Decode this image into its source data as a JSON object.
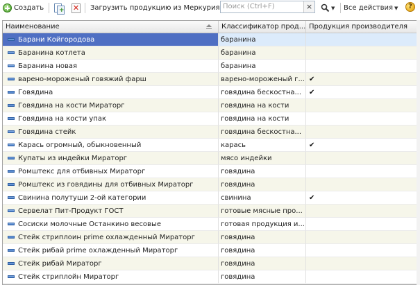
{
  "toolbar": {
    "create_label": "Создать",
    "load_label": "Загрузить продукцию из Меркурия",
    "search_placeholder": "Поиск (Ctrl+F)",
    "all_actions_label": "Все действия",
    "search_clear": "×",
    "help": "?"
  },
  "table": {
    "columns": [
      "Наименование",
      "Классификатор прод...",
      "Продукция производителя"
    ],
    "selected_row": 0,
    "rows": [
      {
        "name": "Барани Койгородова",
        "cls": "баранина",
        "own": ""
      },
      {
        "name": "Баранина котлета",
        "cls": "баранина",
        "own": ""
      },
      {
        "name": "Баранина новая",
        "cls": "баранина",
        "own": ""
      },
      {
        "name": "варено-мороженый говяжий фарш",
        "cls": "варено-мороженый г...",
        "own": "✔"
      },
      {
        "name": "Говядина",
        "cls": "говядина бескостна...",
        "own": "✔"
      },
      {
        "name": "Говядина на кости Мираторг",
        "cls": "говядина на кости",
        "own": ""
      },
      {
        "name": "Говядина на кости упак",
        "cls": "говядина на кости",
        "own": ""
      },
      {
        "name": "Говядина стейк",
        "cls": "говядина бескостна...",
        "own": ""
      },
      {
        "name": "Карась огромный, обыкновенный",
        "cls": "карась",
        "own": "✔"
      },
      {
        "name": "Купаты из индейки Мираторг",
        "cls": "мясо индейки",
        "own": ""
      },
      {
        "name": "Ромштекс для отбивных Мираторг",
        "cls": "говядина",
        "own": ""
      },
      {
        "name": "Ромштекс из говядины для отбивных Мираторг",
        "cls": "говядина",
        "own": ""
      },
      {
        "name": "Свинина полутуши 2-ой категории",
        "cls": "свинина",
        "own": "✔"
      },
      {
        "name": "Сервелат Пит-Продукт ГОСТ",
        "cls": "готовые мясные про...",
        "own": ""
      },
      {
        "name": "Сосиски молочные Останкино весовые",
        "cls": "готовая продукция и...",
        "own": ""
      },
      {
        "name": "Стейк стриплоин prime охлажденный Мираторг",
        "cls": "говядина",
        "own": ""
      },
      {
        "name": "Стейк рибай prime охлажденный Мираторг",
        "cls": "говядина",
        "own": ""
      },
      {
        "name": "Стейк рибай Мираторг",
        "cls": "говядина",
        "own": ""
      },
      {
        "name": "Стейк стриплойн Мираторг",
        "cls": "говядина",
        "own": ""
      }
    ]
  },
  "colors": {
    "selection": "#4f6fc3",
    "alt_row": "#f6f6ea",
    "border": "#a3a3a3"
  },
  "icons": [
    "create-icon",
    "copy-icon",
    "delete-icon",
    "search-clear-icon",
    "find-icon",
    "help-icon",
    "row-item-icon",
    "sort-icon",
    "check-icon"
  ]
}
